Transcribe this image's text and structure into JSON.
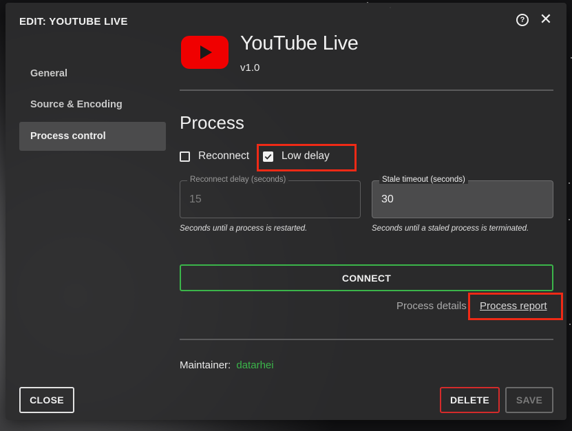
{
  "dialog": {
    "title": "EDIT: YOUTUBE LIVE",
    "help_icon": "help-circle-icon",
    "close_icon": "close-icon"
  },
  "sidebar": {
    "items": [
      {
        "label": "General",
        "active": false
      },
      {
        "label": "Source & Encoding",
        "active": false
      },
      {
        "label": "Process control",
        "active": true
      }
    ]
  },
  "app": {
    "name": "YouTube Live",
    "version": "v1.0",
    "logo_icon": "youtube-logo-icon",
    "logo_color": "#f00000"
  },
  "process": {
    "title": "Process",
    "reconnect": {
      "label": "Reconnect",
      "checked": false
    },
    "low_delay": {
      "label": "Low delay",
      "checked": true
    },
    "reconnect_delay": {
      "label": "Reconnect delay (seconds)",
      "value": "15",
      "helper": "Seconds until a process is restarted."
    },
    "stale_timeout": {
      "label": "Stale timeout (seconds)",
      "value": "30",
      "helper": "Seconds until a staled process is terminated."
    },
    "connect_label": "CONNECT",
    "details_label": "Process details",
    "report_label": "Process report"
  },
  "maintainer": {
    "label": "Maintainer:",
    "name": "datarhei"
  },
  "footer": {
    "close_label": "CLOSE",
    "delete_label": "DELETE",
    "save_label": "SAVE"
  },
  "colors": {
    "accent_green": "#3bb54a",
    "danger_red": "#d42b2b",
    "highlight_red": "#ef2a16"
  }
}
